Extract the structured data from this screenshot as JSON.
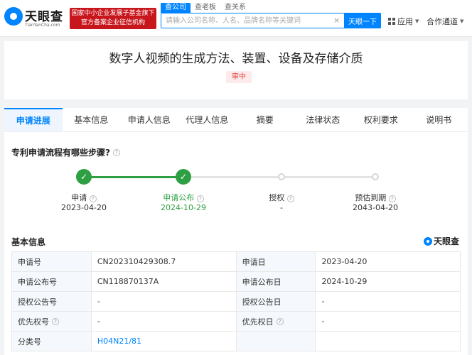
{
  "header": {
    "logo_text": "天眼查",
    "logo_sub": "TianYanCha.com",
    "gov_banner_line1": "国家中小企业发展子基金旗下",
    "gov_banner_line2": "官方备案企业征信机构",
    "search_tabs": [
      "查公司",
      "查老板",
      "查关系"
    ],
    "search_placeholder": "请输入公司名称、人名、品牌名称等关键词",
    "search_button": "天眼一下",
    "nav_apps": "应用",
    "nav_coop": "合作通道"
  },
  "title": {
    "text": "数字人视频的生成方法、装置、设备及存储介质",
    "status": "审中"
  },
  "tabs": [
    "申请进展",
    "基本信息",
    "申请人信息",
    "代理人信息",
    "摘要",
    "法律状态",
    "权利要求",
    "说明书"
  ],
  "progress": {
    "question": "专利申请流程有哪些步骤?",
    "steps": [
      {
        "label": "申请",
        "date": "2023-04-20",
        "state": "done"
      },
      {
        "label": "申请公布",
        "date": "2024-10-29",
        "state": "current"
      },
      {
        "label": "授权",
        "date": "-",
        "state": "todo"
      },
      {
        "label": "预估到期",
        "date": "2043-04-20",
        "state": "todo"
      }
    ]
  },
  "basic_info": {
    "title": "基本信息",
    "brand": "天眼查",
    "rows": [
      {
        "k1": "申请号",
        "v1": "CN202310429308.7",
        "k2": "申请日",
        "v2": "2023-04-20"
      },
      {
        "k1": "申请公布号",
        "v1": "CN118870137A",
        "k2": "申请公布日",
        "v2": "2024-10-29"
      },
      {
        "k1": "授权公告号",
        "v1": "-",
        "k2": "授权公告日",
        "v2": "-"
      },
      {
        "k1": "优先权号",
        "v1": "-",
        "k2": "优先权日",
        "v2": "-"
      },
      {
        "k1": "分类号",
        "v1": "H04N21/81",
        "k2": "",
        "v2": ""
      }
    ]
  }
}
